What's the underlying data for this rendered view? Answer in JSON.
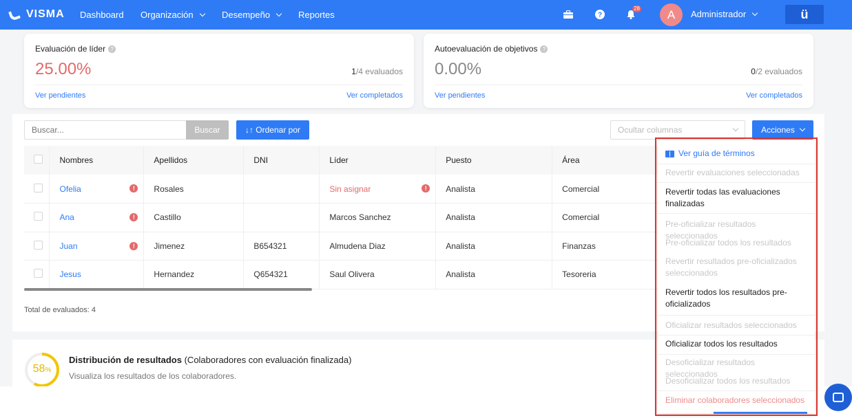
{
  "nav": {
    "logo": "VISMA",
    "items": [
      "Dashboard",
      "Organización",
      "Desempeño",
      "Reportes"
    ],
    "notif_count": "28",
    "avatar_letter": "A",
    "user": "Administrador",
    "brand_glyph": "ü"
  },
  "cards": [
    {
      "title": "Evaluación de líder",
      "pct": "25.00%",
      "count_done": "1",
      "count_total": "/4 evaluados",
      "link_left": "Ver pendientes",
      "link_right": "Ver completados"
    },
    {
      "title": "Autoevaluación de objetivos",
      "pct": "0.00%",
      "count_done": "0",
      "count_total": "/2 evaluados",
      "link_left": "Ver pendientes",
      "link_right": "Ver completados"
    }
  ],
  "toolbar": {
    "search_placeholder": "Buscar...",
    "search_btn": "Buscar",
    "sort_btn": "↓↑ Ordenar por",
    "hide_columns": "Ocultar columnas",
    "actions": "Acciones"
  },
  "table": {
    "headers": [
      "Nombres",
      "Apellidos",
      "DNI",
      "Líder",
      "Puesto",
      "Área"
    ],
    "rows": [
      {
        "nombre": "Ofelia",
        "apellido": "Rosales",
        "dni": "",
        "lider": "Sin asignar",
        "puesto": "Analista",
        "area": "Comercial"
      },
      {
        "nombre": "Ana",
        "apellido": "Castillo",
        "dni": "",
        "lider": "Marcos Sanchez",
        "puesto": "Analista",
        "area": "Comercial"
      },
      {
        "nombre": "Juan",
        "apellido": "Jimenez",
        "dni": "B654321",
        "lider": "Almudena Diaz",
        "puesto": "Analista",
        "area": "Finanzas"
      },
      {
        "nombre": "Jesus",
        "apellido": "Hernandez",
        "dni": "Q654321",
        "lider": "Saul Olivera",
        "puesto": "Analista",
        "area": "Tesoreria"
      }
    ],
    "total": "Total de evaluados: 4"
  },
  "distribution": {
    "pct": "58",
    "pct_unit": "%",
    "title_bold": "Distribución de resultados",
    "title_rest": " (Colaboradores con evaluación finalizada)",
    "subtitle": "Visualiza los resultados de los colaboradores."
  },
  "dropdown": {
    "guide": "Ver guía de términos",
    "items": [
      "Revertir evaluaciones seleccionadas",
      "Revertir todas las evaluaciones finalizadas",
      "Pre-oficializar resultados seleccionados",
      "Pre-oficializar todos los resultados",
      "Revertir resultados pre-oficializados seleccionados",
      "Revertir todos los resultados pre-oficializados",
      "Oficializar resultados seleccionados",
      "Oficializar todos los resultados",
      "Desoficializar resultados seleccionados",
      "Desoficializar todos los resultados",
      "Eliminar colaboradores seleccionados"
    ]
  }
}
